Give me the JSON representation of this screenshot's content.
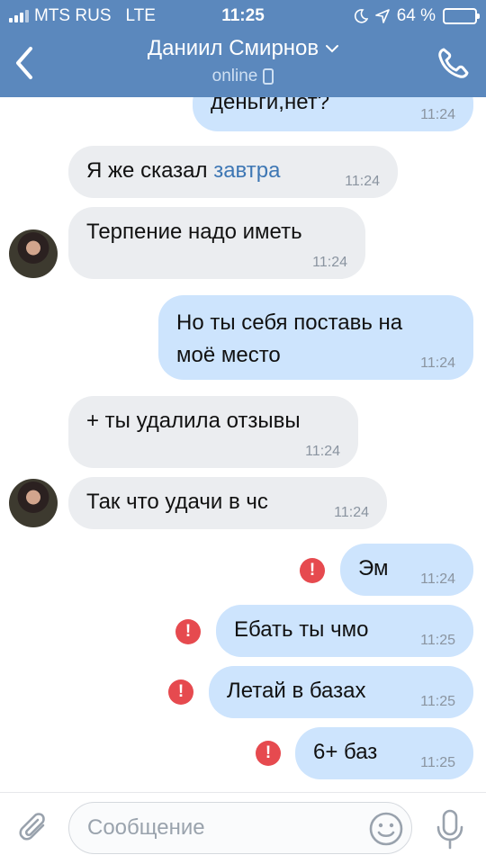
{
  "status": {
    "carrier": "MTS RUS",
    "network": "LTE",
    "time": "11:25",
    "battery": "64 %",
    "battery_level": 0.64
  },
  "header": {
    "title": "Даниил Смирнов",
    "subtitle": "online",
    "icons": {
      "back": "chevron-left-icon",
      "dropdown": "chevron-down-icon",
      "call": "phone-icon",
      "device": "mobile-device-icon"
    }
  },
  "messages": [
    {
      "side": "out",
      "text": "деньги,нет?",
      "time": "11:24"
    },
    {
      "side": "in",
      "text_pre": "Я же сказал ",
      "link": "завтра",
      "time": "11:24"
    },
    {
      "side": "in",
      "text": "Терпение надо иметь",
      "time": "11:24",
      "avatar": true
    },
    {
      "side": "out",
      "text": "Но ты себя поставь на моё место",
      "time": "11:24"
    },
    {
      "side": "in",
      "text": "+ ты удалила отзывы",
      "time": "11:24"
    },
    {
      "side": "in",
      "text": "Так что удачи в чс",
      "time": "11:24",
      "avatar": true
    },
    {
      "side": "out",
      "text": "Эм",
      "time": "11:24",
      "error": true
    },
    {
      "side": "out",
      "text": "Ебать ты чмо",
      "time": "11:25",
      "error": true
    },
    {
      "side": "out",
      "text": "Летай в базах",
      "time": "11:25",
      "error": true
    },
    {
      "side": "out",
      "text": "6+ баз",
      "time": "11:25",
      "error": true
    }
  ],
  "composer": {
    "placeholder": "Сообщение",
    "icons": {
      "attach": "paperclip-icon",
      "emoji": "smile-icon",
      "voice": "microphone-icon"
    }
  },
  "colors": {
    "header": "#5b88bd",
    "incoming": "#ebedf0",
    "outgoing": "#cde4fd",
    "link": "#3e77b4",
    "error": "#e64a4f"
  }
}
